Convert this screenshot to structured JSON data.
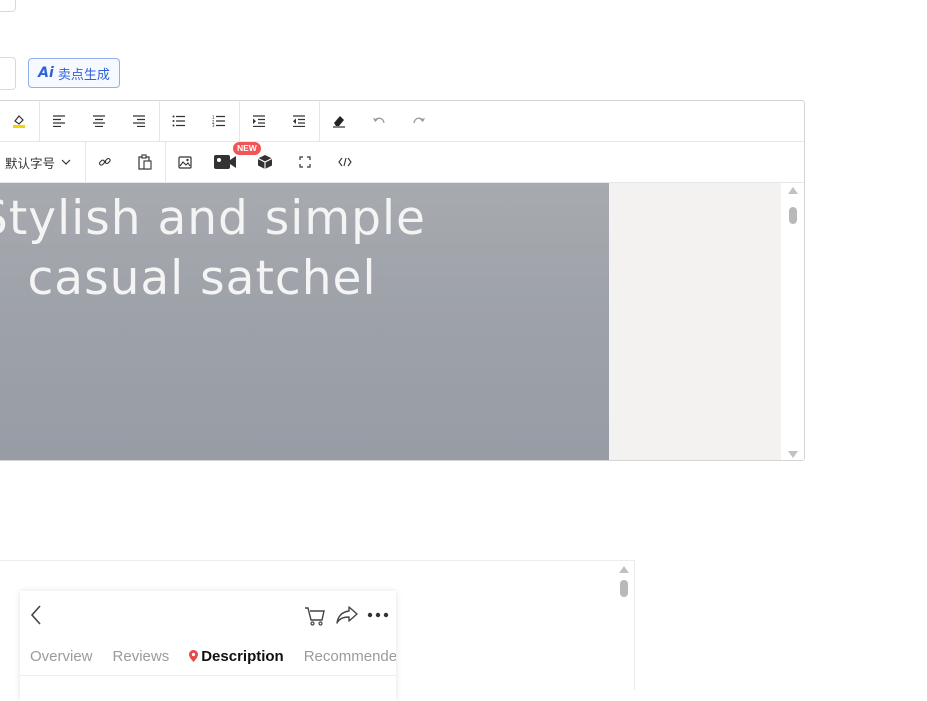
{
  "ai_generate": {
    "icon": "ai-sparkle-icon",
    "label": "卖点生成"
  },
  "editor": {
    "toolbar_row1": [
      {
        "name": "highlight-color-icon"
      },
      {
        "name": "align-left-icon"
      },
      {
        "name": "align-center-icon"
      },
      {
        "name": "align-right-icon"
      },
      {
        "name": "bulleted-list-icon"
      },
      {
        "name": "numbered-list-icon"
      },
      {
        "name": "indent-increase-icon"
      },
      {
        "name": "indent-decrease-icon"
      },
      {
        "name": "clear-format-icon"
      },
      {
        "name": "undo-icon"
      },
      {
        "name": "redo-icon"
      }
    ],
    "font_size_label": "默认字号",
    "new_badge": "NEW",
    "hero_title_line1": "Stylish and simple",
    "hero_title_line2": "casual satchel",
    "colors": {
      "accent": "#2f62d6",
      "badge": "#f05454",
      "hero_bg": "#9da1a8"
    }
  },
  "preview": {
    "tabs": [
      {
        "label": "Overview",
        "active": false
      },
      {
        "label": "Reviews",
        "active": false
      },
      {
        "label": "Description",
        "active": true
      },
      {
        "label": "Recommended",
        "active": false
      }
    ],
    "icons": [
      "back-arrow-icon",
      "cart-icon",
      "share-icon",
      "more-dots-icon",
      "location-pin-icon"
    ]
  }
}
